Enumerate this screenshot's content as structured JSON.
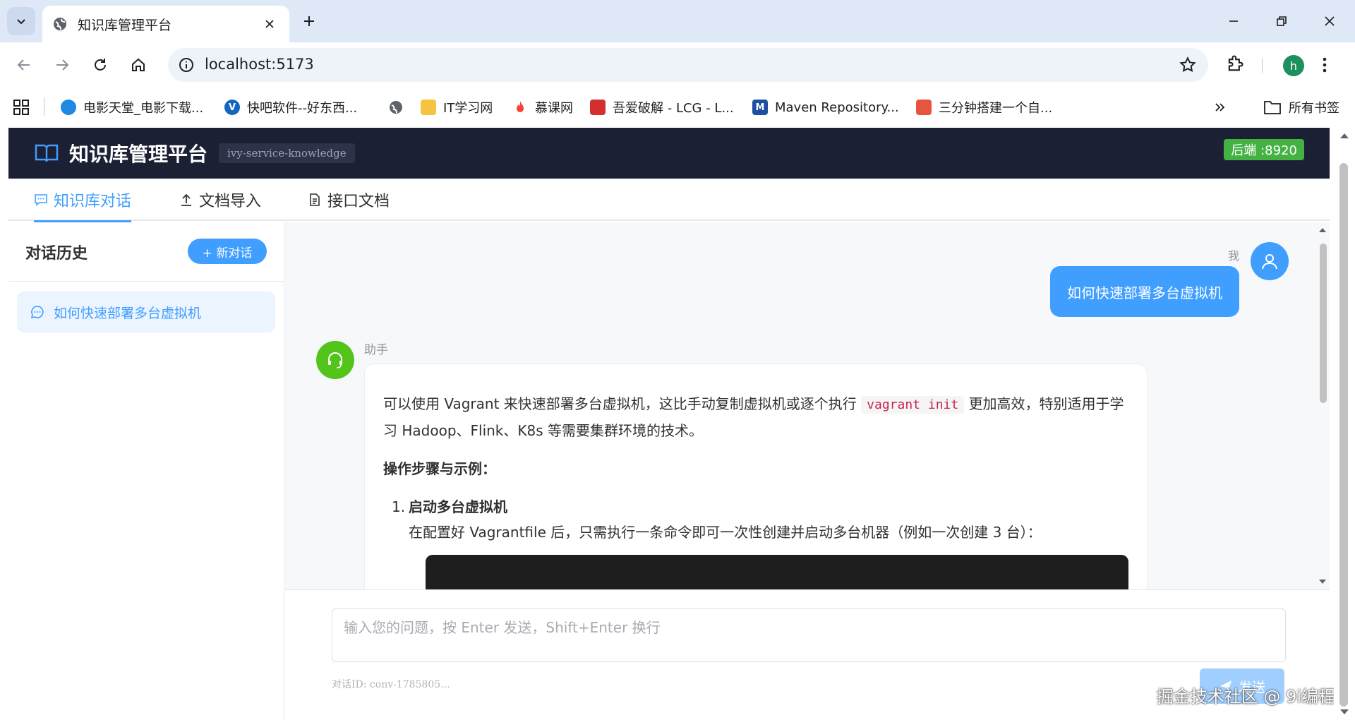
{
  "browser": {
    "tab_title": "知识库管理平台",
    "url": "localhost:5173",
    "profile_initial": "h",
    "bookmarks": [
      {
        "label": "电影天堂_电影下载...",
        "icon": "movie-heaven-icon",
        "color": "#1e88e5"
      },
      {
        "label": "快吧软件--好东西...",
        "icon": "kuaiba-icon",
        "color": "#1565c0"
      },
      {
        "label": "",
        "icon": "globe-icon",
        "color": "#5f6368"
      },
      {
        "label": "IT学习网",
        "icon": "it-study-icon",
        "color": "#f6c343"
      },
      {
        "label": "慕课网",
        "icon": "imooc-flame-icon",
        "color": "#f44336"
      },
      {
        "label": "吾爱破解 - LCG - L...",
        "icon": "52pojie-icon",
        "color": "#d32f2f"
      },
      {
        "label": "Maven Repository...",
        "icon": "maven-icon",
        "color": "#1e4fa0"
      },
      {
        "label": "三分钟搭建一个自...",
        "icon": "jianshu-icon",
        "color": "#e8553e"
      }
    ],
    "all_bookmarks_label": "所有书签"
  },
  "app": {
    "title": "知识库管理平台",
    "service_tag": "ivy-service-knowledge",
    "backend_badge": "后端 :8920",
    "nav_tabs": [
      {
        "label": "知识库对话",
        "icon": "chat-icon",
        "active": true
      },
      {
        "label": "文档导入",
        "icon": "upload-icon",
        "active": false
      },
      {
        "label": "接口文档",
        "icon": "document-icon",
        "active": false
      }
    ]
  },
  "sidebar": {
    "title": "对话历史",
    "new_chat_label": "+ 新对话",
    "conversations": [
      {
        "title": "如何快速部署多台虚拟机",
        "active": true
      }
    ]
  },
  "chat": {
    "user_label": "我",
    "user_message": "如何快速部署多台虚拟机",
    "assistant_label": "助手",
    "assistant": {
      "intro_before_code": "可以使用 Vagrant 来快速部署多台虚拟机，这比手动复制虚拟机或逐个执行",
      "inline_code": "vagrant init",
      "intro_after_code": "更加高效，特别适用于学习 Hadoop、Flink、K8s 等需要集群环境的技术。",
      "steps_heading": "操作步骤与示例：",
      "step1_number": "1.",
      "step1_title": "启动多台虚拟机",
      "step1_text": "在配置好 Vagrantfile 后，只需执行一条命令即可一次性创建并启动多台机器（例如一次创建 3 台）："
    }
  },
  "input": {
    "placeholder": "输入您的问题，按 Enter 发送，Shift+Enter 换行",
    "value": "",
    "conversation_id": "对话ID: conv-1785805...",
    "send_label": "发送"
  },
  "watermark": "掘金技术社区 @ 9i编程",
  "colors": {
    "accent": "#409eff",
    "header_bg": "#1c2035",
    "backend_badge": "#43b243",
    "assistant_avatar": "#52c41a"
  }
}
